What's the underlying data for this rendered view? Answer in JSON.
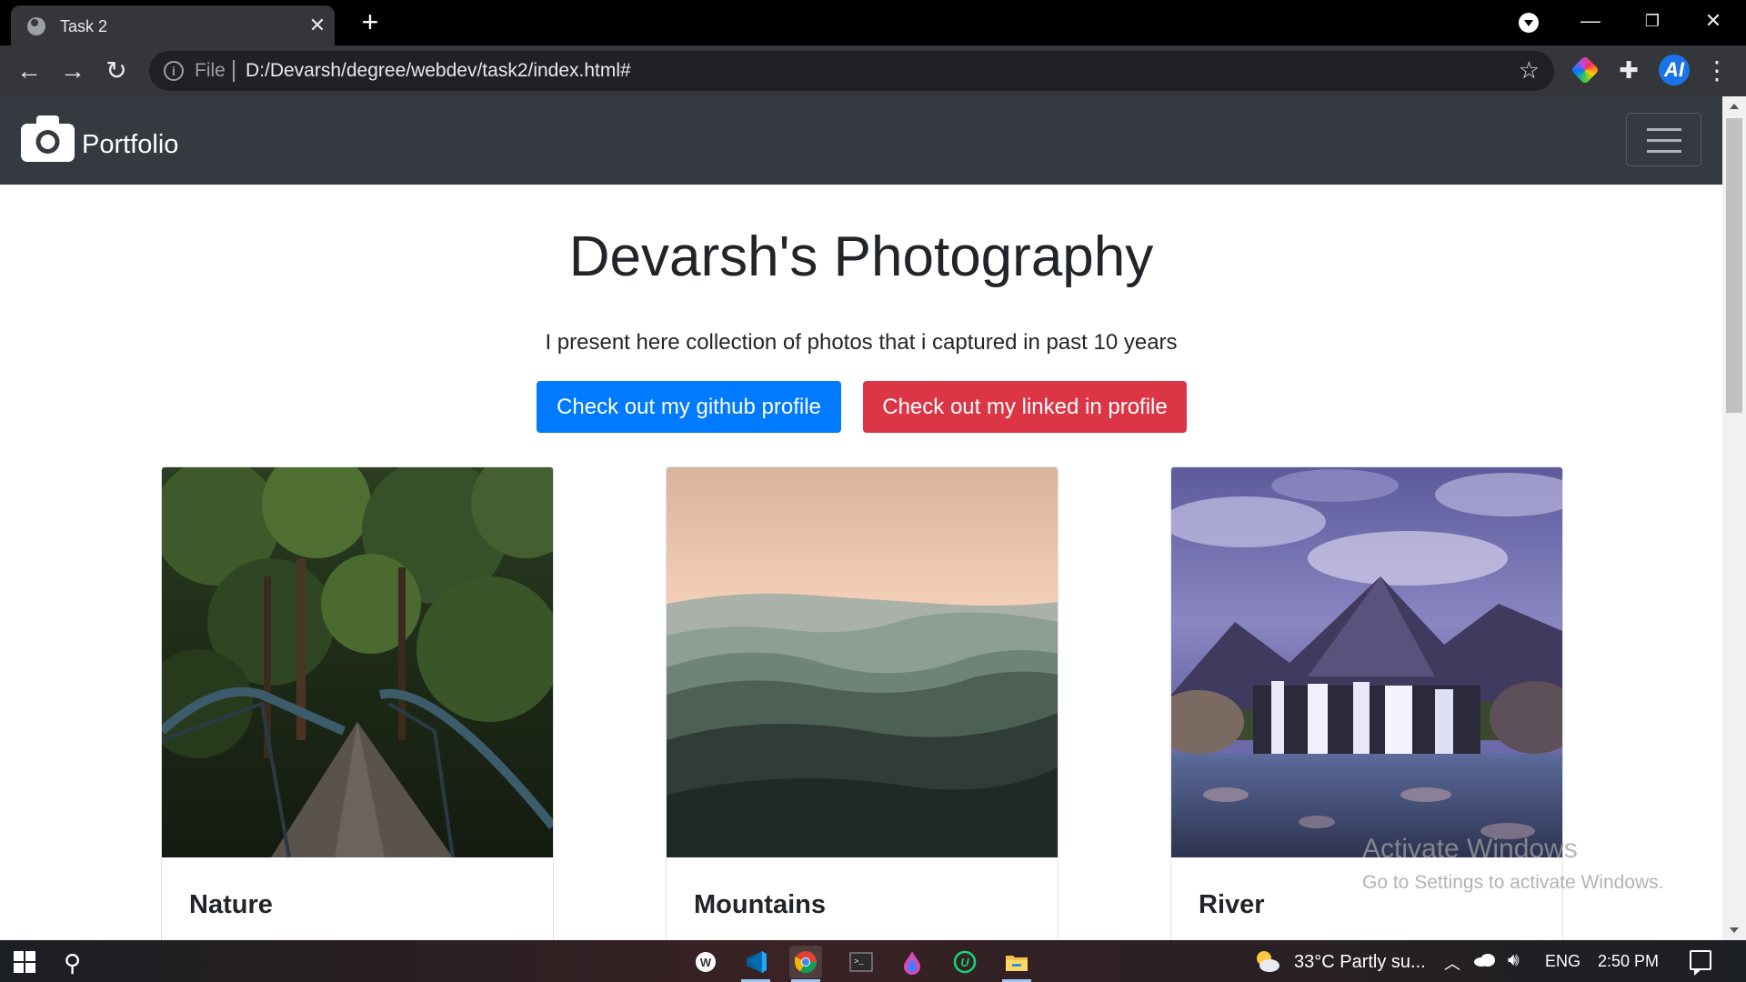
{
  "browser": {
    "tab_title": "Task 2",
    "address_scheme_label": "File",
    "address_url": "D:/Devarsh/degree/webdev/task2/index.html#"
  },
  "site": {
    "brand": "Portfolio",
    "heading": "Devarsh's Photography",
    "lead": "I present here collection of photos that i captured in past 10 years",
    "buttons": {
      "github": "Check out my github profile",
      "linkedin": "Check out my linked in profile"
    },
    "cards": [
      {
        "title": "Nature",
        "icon": "bridge-forest-photo"
      },
      {
        "title": "Mountains",
        "icon": "misty-mountains-photo"
      },
      {
        "title": "River",
        "icon": "waterfall-river-photo"
      }
    ],
    "colors": {
      "navbar": "#343a40",
      "primary": "#007bff",
      "danger": "#dc3545"
    }
  },
  "watermark": {
    "line1": "Activate Windows",
    "line2": "Go to Settings to activate Windows."
  },
  "taskbar": {
    "weather": "33°C  Partly su...",
    "language": "ENG",
    "time": "2:50 PM"
  }
}
